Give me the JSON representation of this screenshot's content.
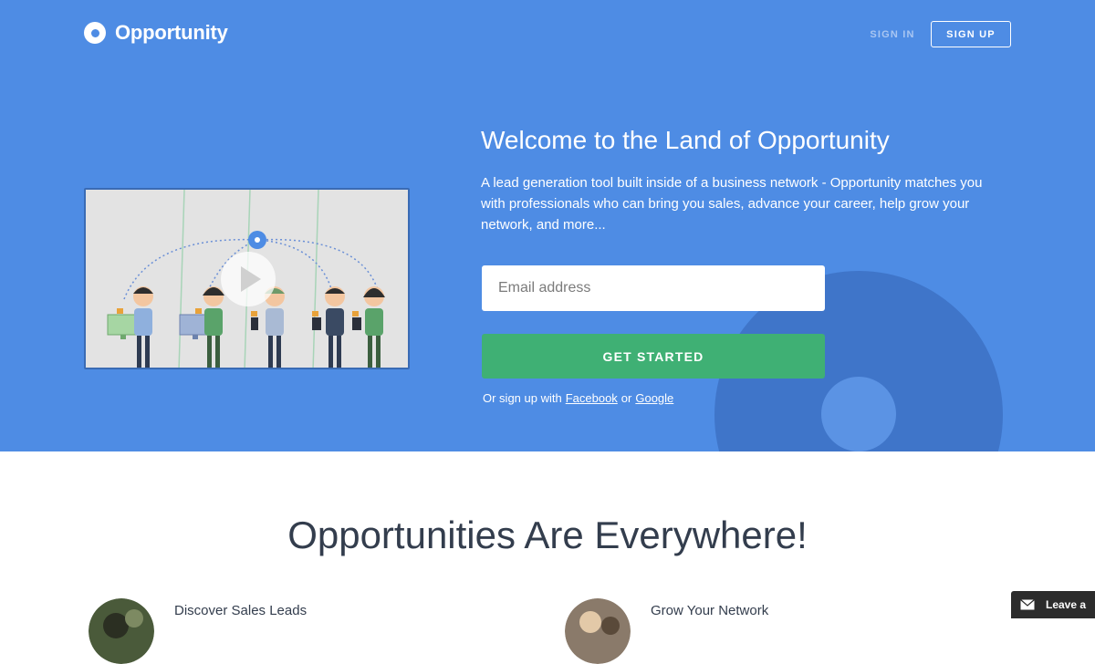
{
  "brand": {
    "name": "Opportunity",
    "icon": "opportunity-logo-icon"
  },
  "nav": {
    "sign_in": "SIGN IN",
    "sign_up": "SIGN UP"
  },
  "hero": {
    "headline": "Welcome to the Land of Opportunity",
    "description": "A lead generation tool built inside of a business network - Opportunity matches you with professionals who can bring you sales, advance your career, help grow your network, and more...",
    "email_placeholder": "Email address",
    "email_value": "",
    "cta_label": "GET STARTED",
    "social_prefix": "Or sign up with",
    "facebook_label": "Facebook",
    "social_or": "or",
    "google_label": "Google",
    "video_icon": "play-icon"
  },
  "section": {
    "title": "Opportunities Are Everywhere!",
    "features": [
      {
        "title": "Discover Sales Leads"
      },
      {
        "title": "Grow Your Network"
      }
    ]
  },
  "feedback": {
    "label": "Leave a",
    "icon": "envelope-icon"
  },
  "colors": {
    "hero_bg": "#4e8ce4",
    "cta": "#3fb074",
    "title_text": "#333d4d"
  }
}
